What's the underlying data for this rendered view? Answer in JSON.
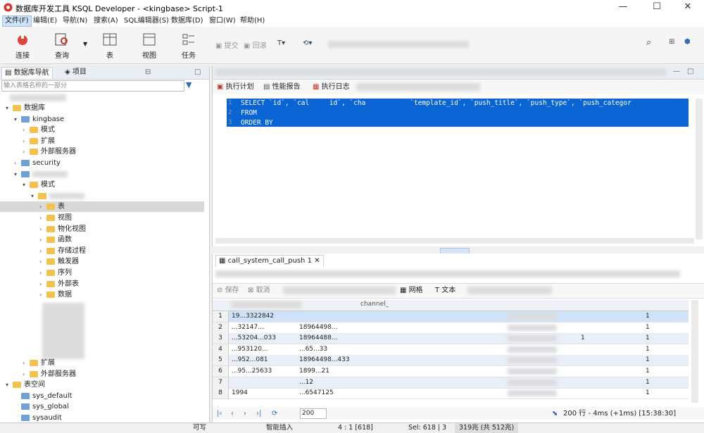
{
  "window": {
    "title": "数据库开发工具 KSQL Developer - <kingbase> Script-1",
    "minimize": "—",
    "maximize": "☐",
    "close": "✕"
  },
  "menu": [
    "文件(F)",
    "编辑(E)",
    "导航(N)",
    "搜索(A)",
    "SQL编辑器(S)",
    "数据库(D)",
    "窗口(W)",
    "帮助(H)"
  ],
  "toolbar": {
    "connect": "连接",
    "query": "查询",
    "table": "表",
    "view": "视图",
    "task": "任务",
    "commit": "提交",
    "rollback": "回滚"
  },
  "nav": {
    "tab_db": "数据库导航",
    "tab_project": "项目",
    "filter_placeholder": "输入表格名称的一部分",
    "tree": [
      {
        "label": "数据库",
        "indent": 1,
        "arrow": "▾",
        "icon": "folder"
      },
      {
        "label": "kingbase",
        "indent": 2,
        "arrow": "▾",
        "icon": "db"
      },
      {
        "label": "模式",
        "indent": 3,
        "arrow": "›",
        "icon": "folder"
      },
      {
        "label": "扩展",
        "indent": 3,
        "arrow": "›",
        "icon": "folder"
      },
      {
        "label": "外部服务器",
        "indent": 3,
        "arrow": "›",
        "icon": "folder"
      },
      {
        "label": "security",
        "indent": 2,
        "arrow": "›",
        "icon": "db"
      },
      {
        "label": "",
        "indent": 2,
        "arrow": "▾",
        "icon": "db"
      },
      {
        "label": "模式",
        "indent": 3,
        "arrow": "▾",
        "icon": "folder"
      },
      {
        "label": "",
        "indent": 4,
        "arrow": "▾",
        "icon": "folder"
      },
      {
        "label": "表",
        "indent": 5,
        "arrow": "›",
        "icon": "folder",
        "hl": true
      },
      {
        "label": "视图",
        "indent": 5,
        "arrow": "›",
        "icon": "folder"
      },
      {
        "label": "物化视图",
        "indent": 5,
        "arrow": "›",
        "icon": "folder"
      },
      {
        "label": "函数",
        "indent": 5,
        "arrow": "›",
        "icon": "folder"
      },
      {
        "label": "存储过程",
        "indent": 5,
        "arrow": "›",
        "icon": "folder"
      },
      {
        "label": "触发器",
        "indent": 5,
        "arrow": "›",
        "icon": "folder"
      },
      {
        "label": "序列",
        "indent": 5,
        "arrow": "›",
        "icon": "folder"
      },
      {
        "label": "外部表",
        "indent": 5,
        "arrow": "›",
        "icon": "folder"
      },
      {
        "label": "数据",
        "indent": 5,
        "arrow": "›",
        "icon": "folder"
      }
    ],
    "tree2": [
      {
        "label": "扩展",
        "indent": 3,
        "arrow": "›",
        "icon": "folder"
      },
      {
        "label": "外部服务器",
        "indent": 3,
        "arrow": "›",
        "icon": "folder"
      },
      {
        "label": "表空间",
        "indent": 1,
        "arrow": "▾",
        "icon": "folder"
      },
      {
        "label": "sys_default",
        "indent": 2,
        "arrow": "",
        "icon": "db"
      },
      {
        "label": "sys_global",
        "indent": 2,
        "arrow": "",
        "icon": "db"
      },
      {
        "label": "sysaudit",
        "indent": 2,
        "arrow": "",
        "icon": "db"
      }
    ]
  },
  "editor": {
    "btn_exec_plan": "执行计划",
    "btn_report": "性能报告",
    "btn_log": "执行日志",
    "lines": [
      "SELECT `id`, `cal     id`, `cha           `template_id`, `push_title`, `push_type`, `push_categor",
      "FROM ",
      "ORDER BY "
    ]
  },
  "result": {
    "tab": "call_system_call_push 1",
    "save": "保存",
    "cancel": "取消",
    "grid": "网格",
    "text": "文本",
    "col_header": "channel_",
    "rows": [
      {
        "n": "1",
        "a": "19...3322842",
        "b": "",
        "c": "",
        "x": "1"
      },
      {
        "n": "2",
        "a": "...32147...",
        "b": "18964498...",
        "c": "",
        "x": "1"
      },
      {
        "n": "3",
        "a": "...53204...033",
        "b": "18964488...",
        "c": "1",
        "x": "1"
      },
      {
        "n": "4",
        "a": "...953120...",
        "b": "...65...33",
        "c": "",
        "x": "1"
      },
      {
        "n": "5",
        "a": "...952...081",
        "b": "18964498...433",
        "c": "",
        "x": "1"
      },
      {
        "n": "6",
        "a": "...95...25633",
        "b": "1899...21",
        "c": "",
        "x": "1"
      },
      {
        "n": "7",
        "a": "",
        "b": "...12",
        "c": "",
        "x": "1"
      },
      {
        "n": "8",
        "a": "1994",
        "b": "...6547125",
        "c": "",
        "x": "1"
      }
    ],
    "page_size": "200",
    "summary": "200 行 - 4ms (+1ms) [15:38:30]"
  },
  "status": {
    "writable": "可写",
    "insert_mode": "智能插入",
    "position": "4 : 1 [618]",
    "sel": "Sel: 618 | 3",
    "memory": "319兆 (共 512兆)"
  },
  "colors": {
    "selection": "#0a64d4",
    "grid_alt": "#e9eef8"
  }
}
